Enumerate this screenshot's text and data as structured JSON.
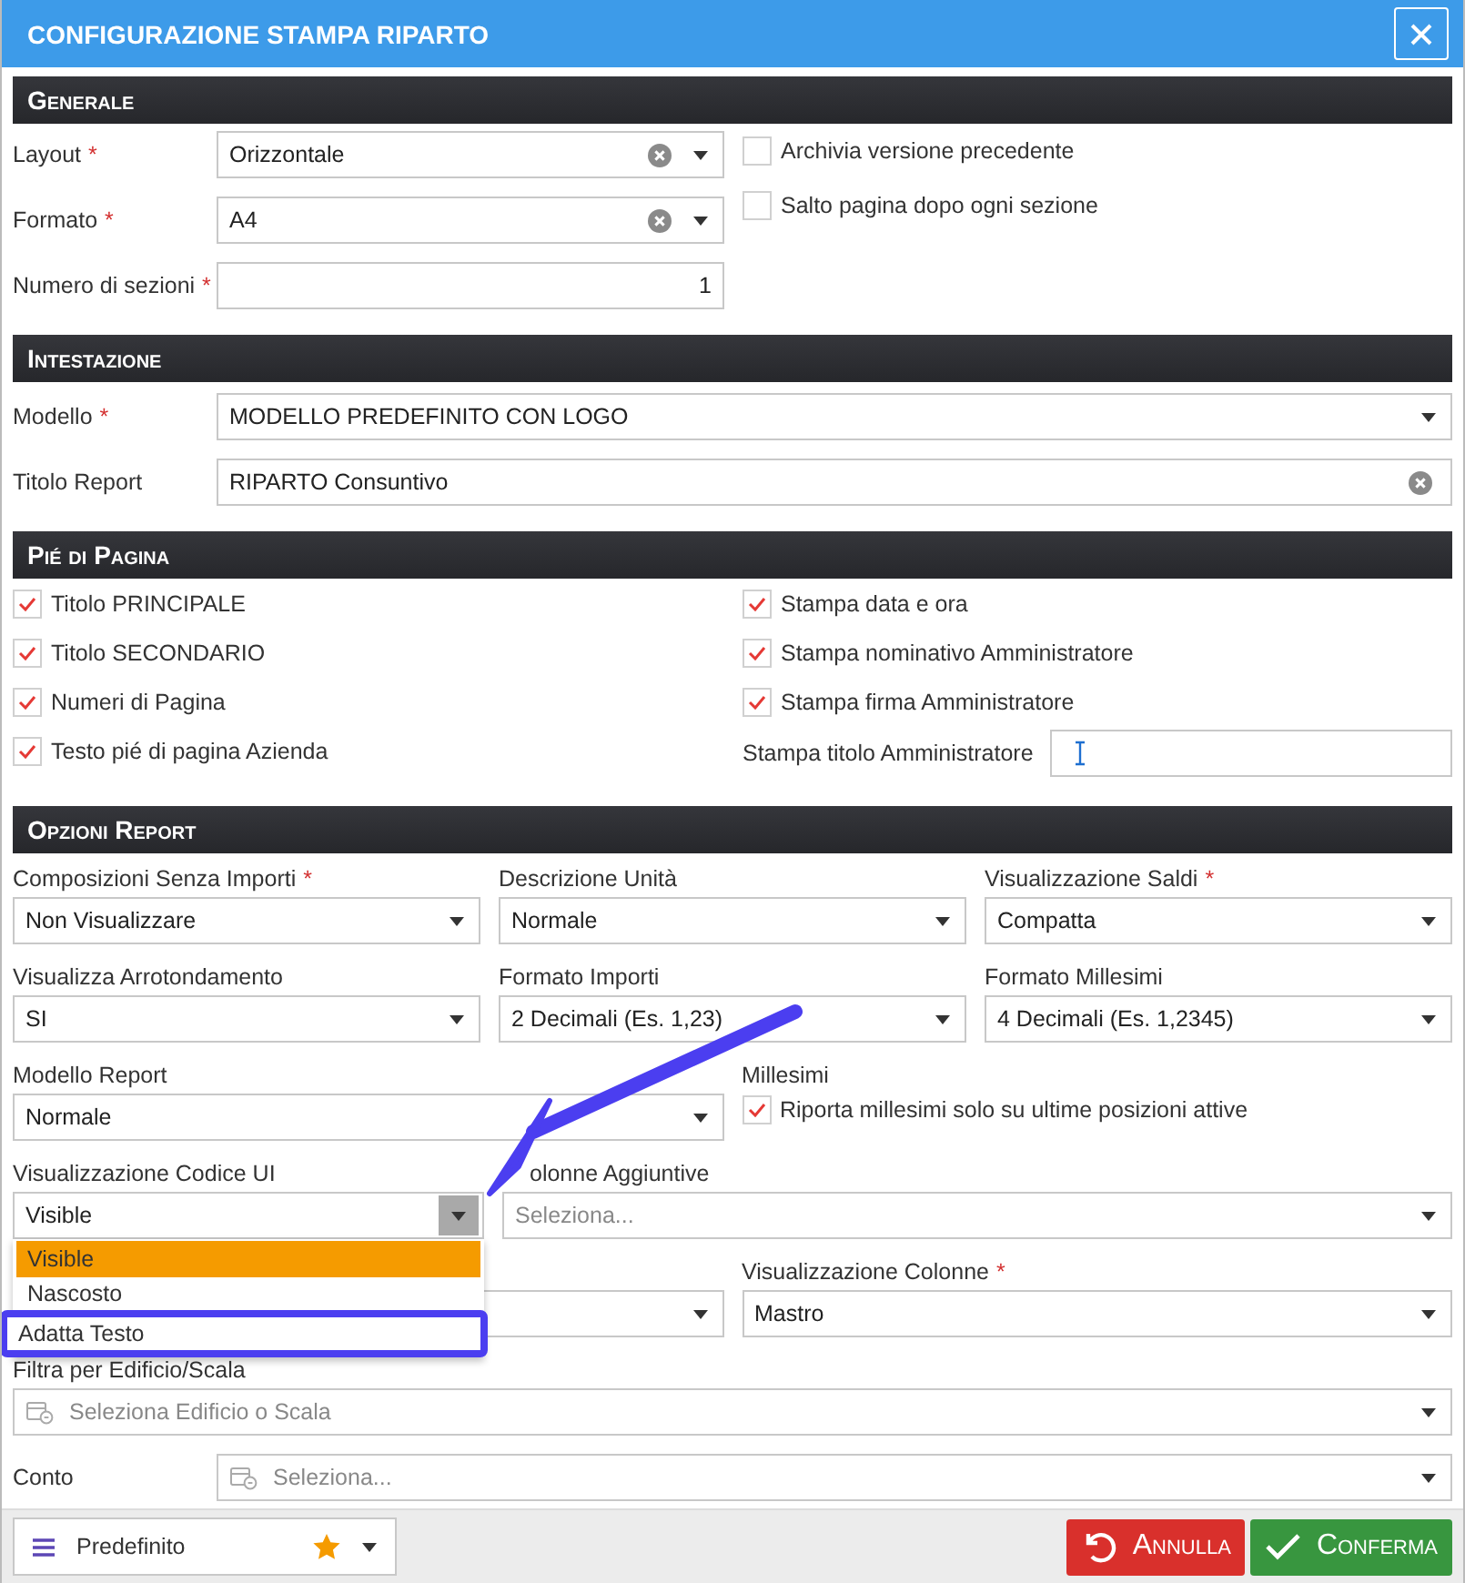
{
  "window": {
    "title": "CONFIGURAZIONE STAMPA RIPARTO"
  },
  "generale": {
    "title": "Generale",
    "fields": [
      {
        "label": "Layout",
        "required_mark": "*",
        "kind": "select",
        "value": "Orizzontale",
        "clearable": true
      },
      {
        "label": "Formato",
        "required_mark": "*",
        "kind": "select",
        "value": "A4",
        "clearable": true
      },
      {
        "label": "Numero di sezioni",
        "required_mark": "*",
        "kind": "number",
        "value": "1",
        "clearable": false
      }
    ],
    "checkboxes": [
      {
        "label": "Archivia versione precedente",
        "checked": false
      },
      {
        "label": "Salto pagina dopo ogni sezione",
        "checked": false
      }
    ]
  },
  "intestazione": {
    "title": "Intestazione",
    "fields": [
      {
        "label": "Modello",
        "required_mark": "*",
        "kind": "select",
        "value": "MODELLO PREDEFINITO CON LOGO",
        "clearable": false
      },
      {
        "label": "Titolo Report",
        "kind": "text",
        "value": "RIPARTO Consuntivo",
        "clearable": true
      }
    ]
  },
  "pie_di_pagina": {
    "title": "Pié di Pagina",
    "left_checkboxes": [
      {
        "label": "Titolo PRINCIPALE",
        "checked": true
      },
      {
        "label": "Titolo SECONDARIO",
        "checked": true
      },
      {
        "label": "Numeri di Pagina",
        "checked": true
      },
      {
        "label": "Testo pié di pagina Azienda",
        "checked": true
      }
    ],
    "right_checkboxes": [
      {
        "label": "Stampa data e ora",
        "checked": true
      },
      {
        "label": "Stampa nominativo Amministratore",
        "checked": true
      },
      {
        "label": "Stampa firma Amministratore",
        "checked": true
      }
    ],
    "title_field": {
      "label": "Stampa titolo Amministratore",
      "focused": true
    }
  },
  "opzioni_report": {
    "title": "Opzioni Report",
    "rows": [
      {
        "kind": "thirds",
        "items": [
          {
            "label": "Composizioni Senza Importi",
            "required_mark": "*",
            "kind": "select",
            "value": "Non Visualizzare"
          },
          {
            "label": "Descrizione Unità",
            "kind": "select",
            "value": "Normale"
          },
          {
            "label": "Visualizzazione Saldi",
            "required_mark": "*",
            "kind": "select",
            "value": "Compatta"
          }
        ]
      },
      {
        "kind": "thirds",
        "items": [
          {
            "label": "Visualizza Arrotondamento",
            "kind": "select",
            "value": "SI"
          },
          {
            "label": "Formato Importi",
            "kind": "select",
            "value": "2 Decimali (Es. 1,23)"
          },
          {
            "label": "Formato Millesimi",
            "kind": "select",
            "value": "4 Decimali (Es. 1,2345)"
          }
        ]
      },
      {
        "kind": "halves",
        "items": [
          {
            "label": "Modello Report",
            "kind": "select",
            "value": "Normale"
          },
          {
            "label": "Millesimi",
            "kind": "checkbox",
            "text": "Riporta millesimi solo su ultime posizioni attive",
            "checked": true
          }
        ]
      },
      {
        "kind": "split",
        "items": [
          {
            "label": "Visualizzazione Codice UI",
            "kind": "select",
            "value": "Visible",
            "open": true,
            "options": [
              {
                "label": "Visible",
                "selected": true,
                "highlighted": false
              },
              {
                "label": "Nascosto",
                "selected": false,
                "highlighted": false
              },
              {
                "label": "Adatta Testo",
                "selected": false,
                "highlighted": true
              }
            ]
          },
          {
            "label": "olonne Aggiuntive",
            "kind": "select",
            "placeholder": "Seleziona..."
          }
        ]
      },
      {
        "kind": "halves",
        "items": [
          {
            "kind": "select"
          },
          {
            "label": "Visualizzazione Colonne",
            "required_mark": "*",
            "kind": "select",
            "value": "Mastro"
          }
        ]
      },
      {
        "kind": "full",
        "items": [
          {
            "label": "Filtra per Edificio/Scala",
            "kind": "picker",
            "placeholder": "Seleziona Edificio o Scala"
          }
        ]
      },
      {
        "kind": "inline",
        "items": [
          {
            "label": "Conto",
            "kind": "picker",
            "placeholder": "Seleziona..."
          }
        ]
      }
    ]
  },
  "footer": {
    "preset": {
      "label": "Predefinito",
      "favorite": true
    },
    "buttons": [
      {
        "label": "Annulla",
        "kind": "cancel"
      },
      {
        "label": "Conferma",
        "kind": "confirm"
      }
    ]
  }
}
